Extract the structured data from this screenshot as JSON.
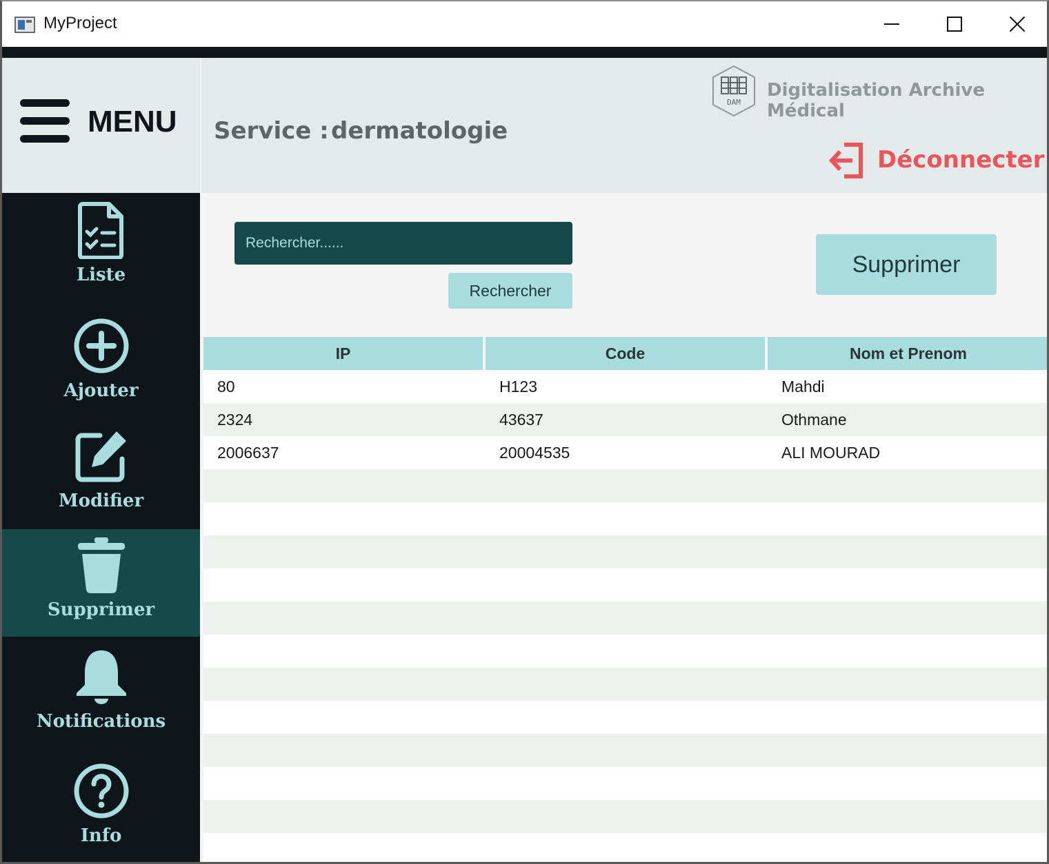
{
  "window": {
    "title": "MyProject"
  },
  "sidebar": {
    "menu_label": "MENU",
    "items": [
      {
        "label": "Liste",
        "icon": "checklist-document-icon",
        "active": false
      },
      {
        "label": "Ajouter",
        "icon": "plus-circle-icon",
        "active": false
      },
      {
        "label": "Modifier",
        "icon": "edit-icon",
        "active": false
      },
      {
        "label": "Supprimer",
        "icon": "trash-icon",
        "active": true
      },
      {
        "label": "Notifications",
        "icon": "bell-icon",
        "active": false
      },
      {
        "label": "Info",
        "icon": "question-circle-icon",
        "active": false
      }
    ]
  },
  "header": {
    "service_label": "Service :",
    "service_value": "dermatologie",
    "brand_name": "Digitalisation Archive Médical",
    "logo_text": "DAM",
    "logout_label": "Déconnecter"
  },
  "search": {
    "placeholder": "Rechercher......",
    "button_label": "Rechercher"
  },
  "actions": {
    "delete_label": "Supprimer"
  },
  "table": {
    "columns": [
      "IP",
      "Code",
      "Nom et Prenom"
    ],
    "rows": [
      [
        "80",
        "H123",
        "Mahdi"
      ],
      [
        "2324",
        "43637",
        "Othmane"
      ],
      [
        "2006637",
        "20004535",
        "ALI MOURAD"
      ]
    ]
  },
  "colors": {
    "sidebar_bg": "#0e161c",
    "active_bg": "#16494a",
    "accent": "#a9dcdf",
    "header_bg": "#e4eaea",
    "logout": "#e8555b"
  }
}
